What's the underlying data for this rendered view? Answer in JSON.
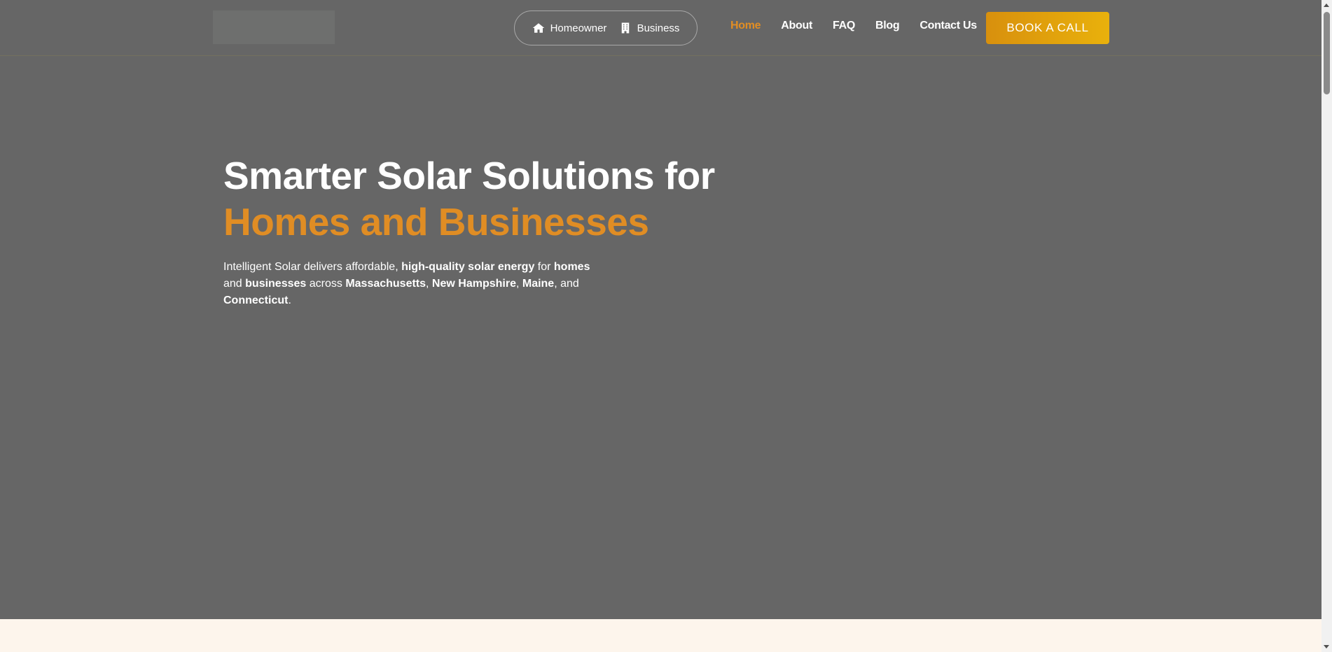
{
  "header": {
    "audience_toggle": [
      {
        "label": "Homeowner",
        "icon": "home-icon"
      },
      {
        "label": "Business",
        "icon": "building-icon"
      }
    ],
    "nav": [
      "Home",
      "About",
      "FAQ",
      "Blog",
      "Contact Us"
    ],
    "active_nav": "Home",
    "cta_label": "BOOK A CALL"
  },
  "hero": {
    "title_line1": "Smarter Solar Solutions for",
    "title_line2": "Homes and Businesses",
    "desc": {
      "p1": "Intelligent Solar delivers affordable, ",
      "b1": "high-quality solar energy",
      "p2": " for ",
      "b2": "homes",
      "p3": " and ",
      "b3": "businesses",
      "p4": " across ",
      "b4": "Massachusetts",
      "p5": ", ",
      "b5": "New Hampshire",
      "p6": ", ",
      "b6": "Maine",
      "p7": ", and ",
      "b7": "Connecticut",
      "p8": "."
    }
  },
  "colors": {
    "accent": "#e08d24",
    "background": "#666666",
    "cta_gradient_start": "#d8900d",
    "cta_gradient_end": "#e9b10c"
  }
}
